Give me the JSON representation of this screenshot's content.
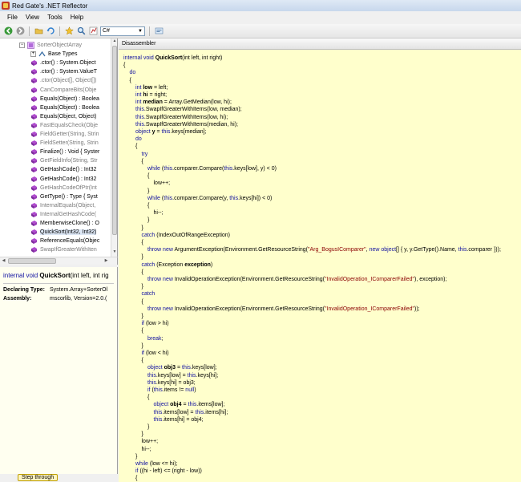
{
  "window": {
    "title": "Red Gate's .NET Reflector"
  },
  "menu": [
    "File",
    "View",
    "Tools",
    "Help"
  ],
  "toolbar": {
    "language": "C#"
  },
  "tree": {
    "items": [
      {
        "label": "SorterObjectArray",
        "icon": "class-icon",
        "gray": true,
        "indent": 0,
        "expander": "−"
      },
      {
        "label": "Base Types",
        "icon": "base-types-icon",
        "gray": false,
        "indent": 1,
        "expander": "+"
      },
      {
        "label": ".ctor() : System.Object",
        "icon": "method-icon",
        "gray": false,
        "indent": 1
      },
      {
        "label": ".ctor() : System.ValueT",
        "icon": "method-icon",
        "gray": false,
        "indent": 1
      },
      {
        "label": ".ctor(Object[], Object[])",
        "icon": "method-icon",
        "gray": true,
        "indent": 1
      },
      {
        "label": "CanCompareBits(Obje",
        "icon": "method-icon",
        "gray": true,
        "indent": 1
      },
      {
        "label": "Equals(Object) : Boolea",
        "icon": "method-icon",
        "gray": false,
        "indent": 1
      },
      {
        "label": "Equals(Object) : Boolea",
        "icon": "method-icon",
        "gray": false,
        "indent": 1
      },
      {
        "label": "Equals(Object, Object)",
        "icon": "method-icon",
        "gray": false,
        "indent": 1
      },
      {
        "label": "FastEqualsCheck(Obje",
        "icon": "method-icon",
        "gray": true,
        "indent": 1
      },
      {
        "label": "FieldGetter(String, Strin",
        "icon": "method-icon",
        "gray": true,
        "indent": 1
      },
      {
        "label": "FieldSetter(String, Strin",
        "icon": "method-icon",
        "gray": true,
        "indent": 1
      },
      {
        "label": "Finalize() : Void { Syster",
        "icon": "method-icon",
        "gray": false,
        "indent": 1
      },
      {
        "label": "GetFieldInfo(String, Str",
        "icon": "method-icon",
        "gray": true,
        "indent": 1
      },
      {
        "label": "GetHashCode() : Int32",
        "icon": "method-icon",
        "gray": false,
        "indent": 1
      },
      {
        "label": "GetHashCode() : Int32",
        "icon": "method-icon",
        "gray": false,
        "indent": 1
      },
      {
        "label": "GetHashCodeOfPtr(Int",
        "icon": "method-icon",
        "gray": true,
        "indent": 1
      },
      {
        "label": "GetType() : Type { Syst",
        "icon": "method-icon",
        "gray": false,
        "indent": 1
      },
      {
        "label": "InternalEquals(Object,",
        "icon": "method-icon",
        "gray": true,
        "indent": 1
      },
      {
        "label": "InternalGetHashCode(",
        "icon": "method-icon",
        "gray": true,
        "indent": 1
      },
      {
        "label": "MemberwiseClone() : O",
        "icon": "method-icon",
        "gray": false,
        "indent": 1
      },
      {
        "label": "QuickSort(Int32, Int32)",
        "icon": "method-icon",
        "gray": false,
        "indent": 1,
        "selected": true
      },
      {
        "label": "ReferenceEquals(Objec",
        "icon": "method-icon",
        "gray": false,
        "indent": 1
      },
      {
        "label": "SwapIfGreaterWithIten",
        "icon": "method-icon",
        "gray": true,
        "indent": 1
      }
    ]
  },
  "info": {
    "sig_kw": "internal void",
    "sig_name": "QuickSort",
    "sig_rest": "(int left, int rig",
    "declaring_key": "Declaring Type:",
    "declaring_val": "System.Array+SorterOl",
    "assembly_key": "Assembly:",
    "assembly_val": "mscorlib, Version=2.0.("
  },
  "status": {
    "tooltip": "Step through"
  },
  "disassembler": {
    "header": "Disassembler",
    "lines": [
      [
        0,
        [
          [
            "kw",
            "internal void "
          ],
          [
            "b",
            "QuickSort"
          ],
          [
            "",
            "(int left, int right)"
          ]
        ]
      ],
      [
        0,
        [
          [
            "",
            "{"
          ]
        ]
      ],
      [
        1,
        [
          [
            "kw",
            "do"
          ]
        ]
      ],
      [
        1,
        [
          [
            "",
            "{"
          ]
        ]
      ],
      [
        2,
        [
          [
            "kw",
            "int "
          ],
          [
            "b",
            "low"
          ],
          [
            "",
            " = left;"
          ]
        ]
      ],
      [
        2,
        [
          [
            "kw",
            "int "
          ],
          [
            "b",
            "hi"
          ],
          [
            "",
            " = right;"
          ]
        ]
      ],
      [
        2,
        [
          [
            "kw",
            "int "
          ],
          [
            "b",
            "median"
          ],
          [
            "",
            " = Array.GetMedian(low, hi);"
          ]
        ]
      ],
      [
        2,
        [
          [
            "kw",
            "this"
          ],
          [
            "",
            ".SwapIfGreaterWithItems(low, median);"
          ]
        ]
      ],
      [
        2,
        [
          [
            "kw",
            "this"
          ],
          [
            "",
            ".SwapIfGreaterWithItems(low, hi);"
          ]
        ]
      ],
      [
        2,
        [
          [
            "kw",
            "this"
          ],
          [
            "",
            ".SwapIfGreaterWithItems(median, hi);"
          ]
        ]
      ],
      [
        2,
        [
          [
            "kw",
            "object "
          ],
          [
            "b",
            "y"
          ],
          [
            "",
            " = "
          ],
          [
            "kw",
            "this"
          ],
          [
            "",
            ".keys[median];"
          ]
        ]
      ],
      [
        2,
        [
          [
            "kw",
            "do"
          ]
        ]
      ],
      [
        2,
        [
          [
            "",
            "{"
          ]
        ]
      ],
      [
        3,
        [
          [
            "kw",
            "try"
          ]
        ]
      ],
      [
        3,
        [
          [
            "",
            "{"
          ]
        ]
      ],
      [
        4,
        [
          [
            "kw",
            "while "
          ],
          [
            "",
            "("
          ],
          [
            "kw",
            "this"
          ],
          [
            "",
            ".comparer.Compare("
          ],
          [
            "kw",
            "this"
          ],
          [
            "",
            ".keys[low], y) < 0)"
          ]
        ]
      ],
      [
        4,
        [
          [
            "",
            "{"
          ]
        ]
      ],
      [
        5,
        [
          [
            "",
            "low++;"
          ]
        ]
      ],
      [
        4,
        [
          [
            "",
            "}"
          ]
        ]
      ],
      [
        4,
        [
          [
            "kw",
            "while "
          ],
          [
            "",
            "("
          ],
          [
            "kw",
            "this"
          ],
          [
            "",
            ".comparer.Compare(y, "
          ],
          [
            "kw",
            "this"
          ],
          [
            "",
            ".keys[hi]) < 0)"
          ]
        ]
      ],
      [
        4,
        [
          [
            "",
            "{"
          ]
        ]
      ],
      [
        5,
        [
          [
            "",
            "hi--;"
          ]
        ]
      ],
      [
        4,
        [
          [
            "",
            "}"
          ]
        ]
      ],
      [
        3,
        [
          [
            "",
            "}"
          ]
        ]
      ],
      [
        3,
        [
          [
            "kw",
            "catch "
          ],
          [
            "",
            "(IndexOutOfRangeException)"
          ]
        ]
      ],
      [
        3,
        [
          [
            "",
            "{"
          ]
        ]
      ],
      [
        4,
        [
          [
            "kw",
            "throw new "
          ],
          [
            "",
            "ArgumentException(Environment.GetResourceString("
          ],
          [
            "str",
            "\"Arg_BogusIComparer\""
          ],
          [
            "",
            ", "
          ],
          [
            "kw",
            "new object"
          ],
          [
            "",
            "[] { y, y.GetType().Name, "
          ],
          [
            "kw",
            "this"
          ],
          [
            "",
            ".comparer }));"
          ]
        ]
      ],
      [
        3,
        [
          [
            "",
            "}"
          ]
        ]
      ],
      [
        3,
        [
          [
            "kw",
            "catch "
          ],
          [
            "",
            "(Exception "
          ],
          [
            "b",
            "exception"
          ],
          [
            "",
            ")"
          ]
        ]
      ],
      [
        3,
        [
          [
            "",
            "{"
          ]
        ]
      ],
      [
        4,
        [
          [
            "kw",
            "throw new "
          ],
          [
            "",
            "InvalidOperationException(Environment.GetResourceString("
          ],
          [
            "str",
            "\"InvalidOperation_IComparerFailed\""
          ],
          [
            "",
            "), exception);"
          ]
        ]
      ],
      [
        3,
        [
          [
            "",
            "}"
          ]
        ]
      ],
      [
        3,
        [
          [
            "kw",
            "catch"
          ]
        ]
      ],
      [
        3,
        [
          [
            "",
            "{"
          ]
        ]
      ],
      [
        4,
        [
          [
            "kw",
            "throw new "
          ],
          [
            "",
            "InvalidOperationException(Environment.GetResourceString("
          ],
          [
            "str",
            "\"InvalidOperation_IComparerFailed\""
          ],
          [
            "",
            "));"
          ]
        ]
      ],
      [
        3,
        [
          [
            "",
            "}"
          ]
        ]
      ],
      [
        3,
        [
          [
            "kw",
            "if "
          ],
          [
            "",
            "(low > hi)"
          ]
        ]
      ],
      [
        3,
        [
          [
            "",
            "{"
          ]
        ]
      ],
      [
        4,
        [
          [
            "kw",
            "break"
          ],
          [
            "",
            ";"
          ]
        ]
      ],
      [
        3,
        [
          [
            "",
            "}"
          ]
        ]
      ],
      [
        3,
        [
          [
            "kw",
            "if "
          ],
          [
            "",
            "(low < hi)"
          ]
        ]
      ],
      [
        3,
        [
          [
            "",
            "{"
          ]
        ]
      ],
      [
        4,
        [
          [
            "kw",
            "object "
          ],
          [
            "b",
            "obj3"
          ],
          [
            "",
            " = "
          ],
          [
            "kw",
            "this"
          ],
          [
            "",
            ".keys[low];"
          ]
        ]
      ],
      [
        4,
        [
          [
            "kw",
            "this"
          ],
          [
            "",
            ".keys[low] = "
          ],
          [
            "kw",
            "this"
          ],
          [
            "",
            ".keys[hi];"
          ]
        ]
      ],
      [
        4,
        [
          [
            "kw",
            "this"
          ],
          [
            "",
            ".keys[hi] = obj3;"
          ]
        ]
      ],
      [
        4,
        [
          [
            "kw",
            "if "
          ],
          [
            "",
            "("
          ],
          [
            "kw",
            "this"
          ],
          [
            "",
            ".items != "
          ],
          [
            "kw",
            "null"
          ],
          [
            "",
            ")"
          ]
        ]
      ],
      [
        4,
        [
          [
            "",
            "{"
          ]
        ]
      ],
      [
        5,
        [
          [
            "kw",
            "object "
          ],
          [
            "b",
            "obj4"
          ],
          [
            "",
            " = "
          ],
          [
            "kw",
            "this"
          ],
          [
            "",
            ".items[low];"
          ]
        ]
      ],
      [
        5,
        [
          [
            "kw",
            "this"
          ],
          [
            "",
            ".items[low] = "
          ],
          [
            "kw",
            "this"
          ],
          [
            "",
            ".items[hi];"
          ]
        ]
      ],
      [
        5,
        [
          [
            "kw",
            "this"
          ],
          [
            "",
            ".items[hi] = obj4;"
          ]
        ]
      ],
      [
        4,
        [
          [
            "",
            "}"
          ]
        ]
      ],
      [
        3,
        [
          [
            "",
            "}"
          ]
        ]
      ],
      [
        3,
        [
          [
            "",
            "low++;"
          ]
        ]
      ],
      [
        3,
        [
          [
            "",
            "hi--;"
          ]
        ]
      ],
      [
        2,
        [
          [
            "",
            "}"
          ]
        ]
      ],
      [
        2,
        [
          [
            "kw",
            "while "
          ],
          [
            "",
            "(low <= hi);"
          ]
        ]
      ],
      [
        2,
        [
          [
            "kw",
            "if "
          ],
          [
            "",
            "((hi - left) <= (right - low))"
          ]
        ]
      ],
      [
        2,
        [
          [
            "",
            "{"
          ]
        ]
      ]
    ]
  }
}
